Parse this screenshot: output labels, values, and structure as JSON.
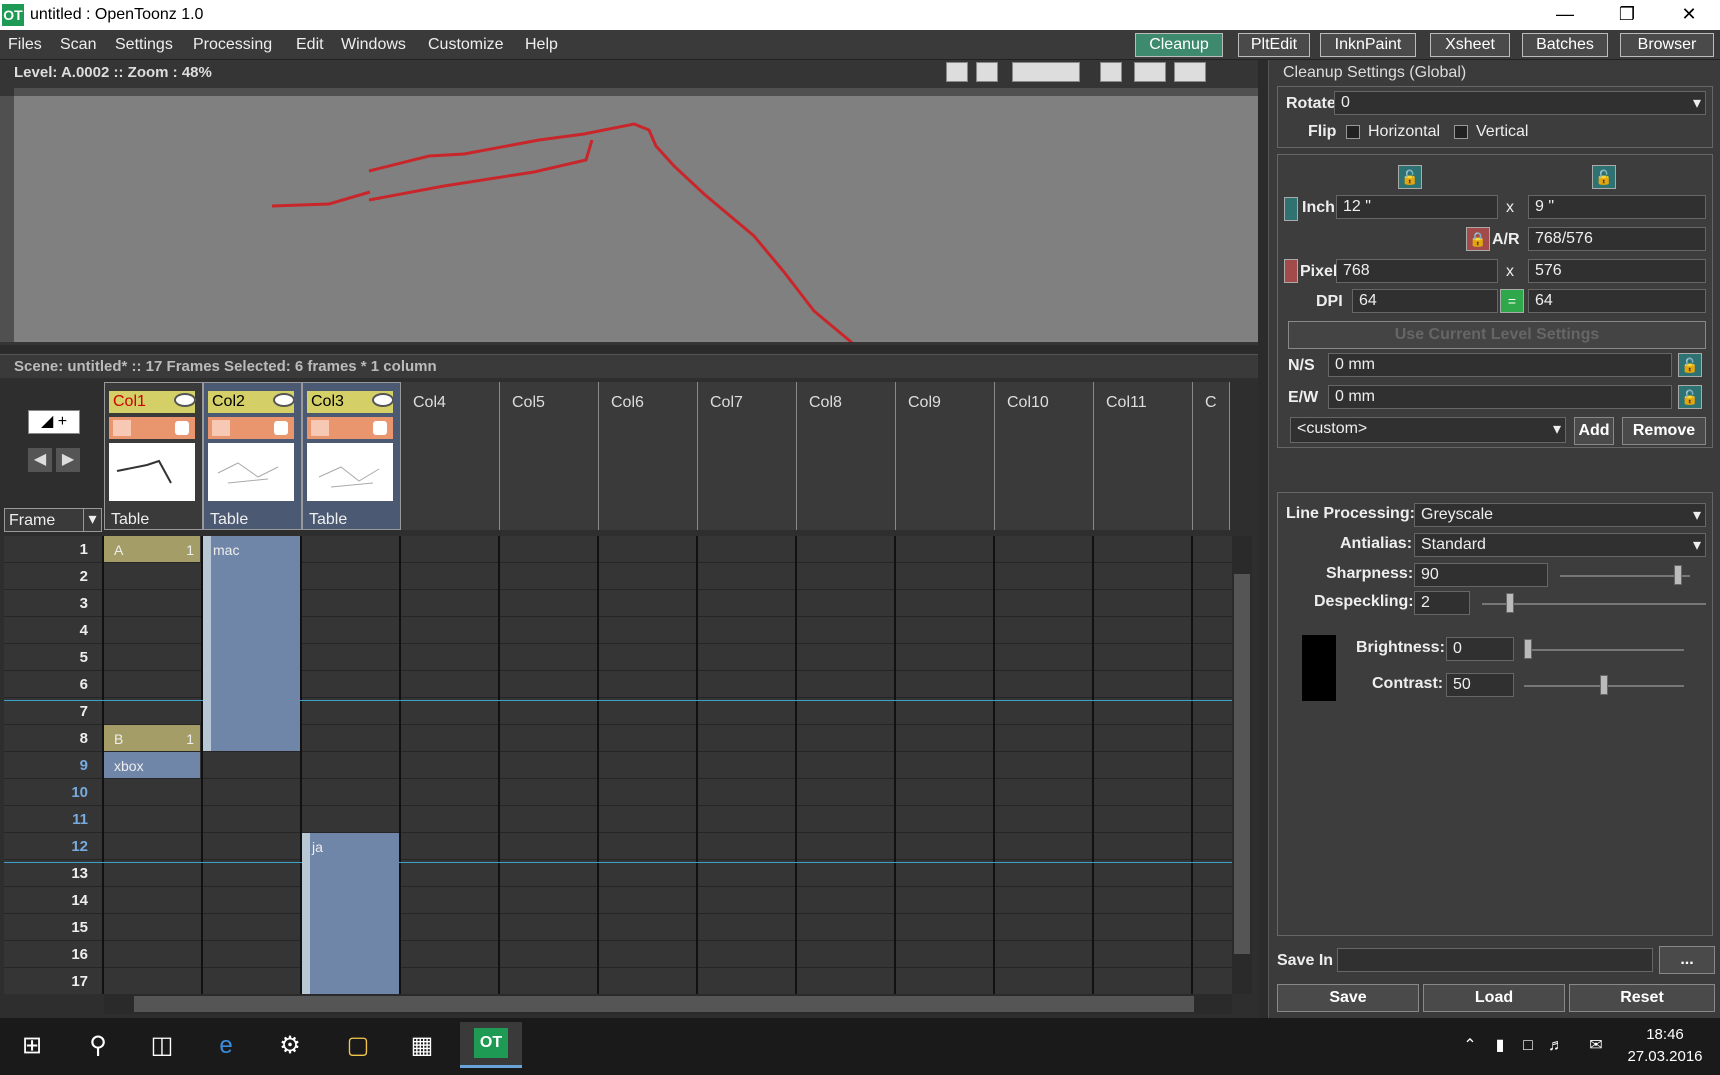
{
  "window": {
    "title": "untitled : OpenToonz 1.0",
    "app_icon": "OT"
  },
  "menu": [
    "Files",
    "Scan",
    "Settings",
    "Processing",
    "Edit",
    "Windows",
    "Customize",
    "Help"
  ],
  "rooms": [
    {
      "label": "Cleanup",
      "active": true
    },
    {
      "label": "PltEdit",
      "active": false
    },
    {
      "label": "InknPaint",
      "active": false
    },
    {
      "label": "Xsheet",
      "active": false
    },
    {
      "label": "Batches",
      "active": false
    },
    {
      "label": "Browser",
      "active": false
    }
  ],
  "viewer": {
    "level_info": "Level: A.0002  ::  Zoom : 48%"
  },
  "scene": {
    "info": "Scene: untitled*   ::   17 Frames   Selected: 6 frames * 1 column"
  },
  "xsheet": {
    "frame_header": "Frame",
    "columns": [
      {
        "name": "Col1",
        "peg": "Table",
        "filled": true
      },
      {
        "name": "Col2",
        "peg": "Table",
        "filled": true
      },
      {
        "name": "Col3",
        "peg": "Table",
        "filled": true
      },
      {
        "name": "Col4"
      },
      {
        "name": "Col5"
      },
      {
        "name": "Col6"
      },
      {
        "name": "Col7"
      },
      {
        "name": "Col8"
      },
      {
        "name": "Col9"
      },
      {
        "name": "Col10"
      },
      {
        "name": "Col11"
      },
      {
        "name": "C"
      }
    ],
    "frames": [
      "1",
      "2",
      "3",
      "4",
      "5",
      "6",
      "7",
      "8",
      "9",
      "10",
      "11",
      "12",
      "13",
      "14",
      "15",
      "16",
      "17"
    ],
    "cells": {
      "col1_a": "A",
      "col1_a_num": "1",
      "col1_b": "B",
      "col1_b_num": "1",
      "col1_xbox": "xbox",
      "col2_mac": "mac",
      "col3_ja": "ja"
    }
  },
  "cleanup": {
    "title": "Cleanup Settings (Global)",
    "rotate_label": "Rotate",
    "rotate_value": "0",
    "flip_label": "Flip",
    "horizontal_label": "Horizontal",
    "vertical_label": "Vertical",
    "inch_label": "Inch",
    "inch_w": "12 \"",
    "inch_h": "9 \"",
    "x": "x",
    "ar_label": "A/R",
    "ar_value": "768/576",
    "pixel_label": "Pixel",
    "pixel_w": "768",
    "pixel_h": "576",
    "dpi_label": "DPI",
    "dpi_x": "64",
    "dpi_y": "64",
    "use_current": "Use Current Level Settings",
    "ns_label": "N/S",
    "ns_value": "0 mm",
    "ew_label": "E/W",
    "ew_value": "0 mm",
    "preset_value": "<custom>",
    "add_label": "Add",
    "remove_label": "Remove",
    "line_processing_label": "Line Processing:",
    "line_processing_value": "Greyscale",
    "antialias_label": "Antialias:",
    "antialias_value": "Standard",
    "sharpness_label": "Sharpness:",
    "sharpness_value": "90",
    "despeckling_label": "Despeckling:",
    "despeckling_value": "2",
    "brightness_label": "Brightness:",
    "brightness_value": "0",
    "contrast_label": "Contrast:",
    "contrast_value": "50",
    "save_in_label": "Save In",
    "browse_label": "...",
    "save_label": "Save",
    "load_label": "Load",
    "reset_label": "Reset"
  },
  "taskbar": {
    "time": "18:46",
    "date": "27.03.2016"
  }
}
